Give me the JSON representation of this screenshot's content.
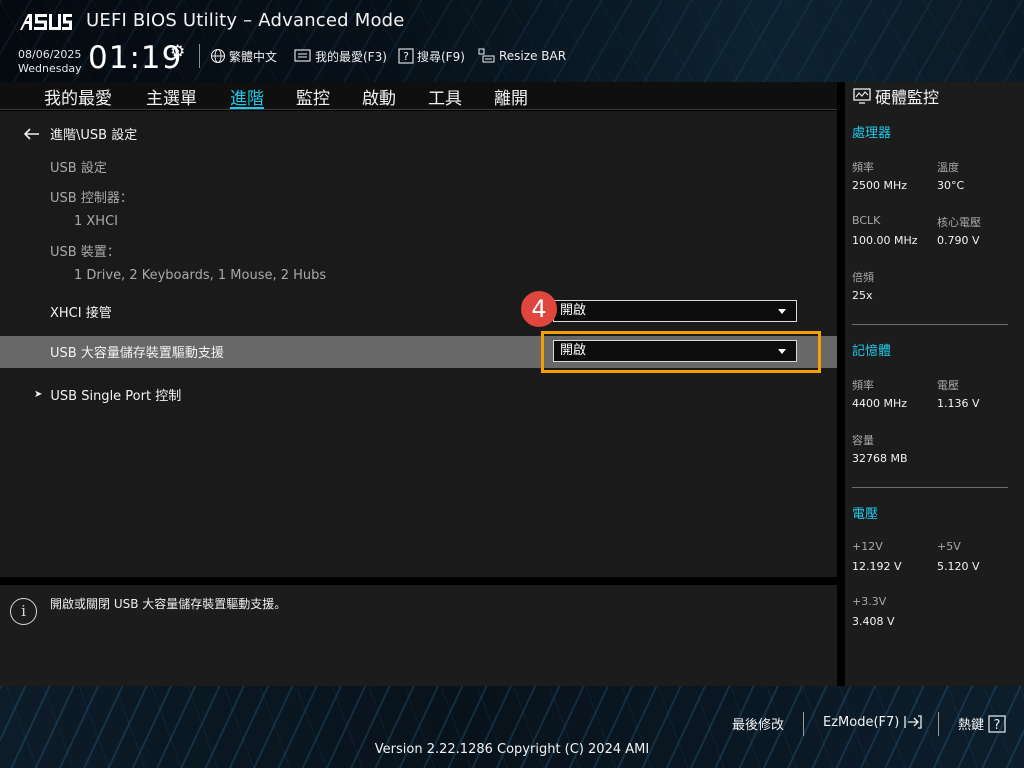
{
  "header": {
    "brand": "ASUS",
    "title": "UEFI BIOS Utility – Advanced Mode",
    "date": "08/06/2025",
    "weekday": "Wednesday",
    "time": "01:19",
    "buttons": {
      "language": "繁體中文",
      "favorites": "我的最愛(F3)",
      "search": "搜尋(F9)",
      "resize_bar": "Resize BAR"
    }
  },
  "tabs": [
    "我的最愛",
    "主選單",
    "進階",
    "監控",
    "啟動",
    "工具",
    "離開"
  ],
  "active_tab": "進階",
  "main": {
    "breadcrumb": "進階\\USB 設定",
    "info": {
      "usb_settings": "USB 設定",
      "controller_label": "USB 控制器：",
      "controller_value": "1 XHCI",
      "devices_label": "USB 裝置：",
      "devices_value": "1 Drive, 2 Keyboards, 1 Mouse, 2 Hubs"
    },
    "items": [
      {
        "label": "XHCI 接管",
        "value": "開啟"
      },
      {
        "label": "USB 大容量儲存裝置驅動支援",
        "value": "開啟"
      }
    ],
    "submenu": "USB Single Port 控制",
    "step_badge": "4"
  },
  "help": {
    "icon": "i",
    "text": "開啟或關閉 USB 大容量儲存裝置驅動支援。"
  },
  "monitor": {
    "title": "硬體監控",
    "cpu": {
      "title": "處理器",
      "freq_label": "頻率",
      "freq": "2500 MHz",
      "temp_label": "溫度",
      "temp": "30°C",
      "bclk_label": "BCLK",
      "bclk": "100.00 MHz",
      "vcore_label": "核心電壓",
      "vcore": "0.790 V",
      "ratio_label": "倍頻",
      "ratio": "25x"
    },
    "memory": {
      "title": "記憶體",
      "freq_label": "頻率",
      "freq": "4400 MHz",
      "volt_label": "電壓",
      "volt": "1.136 V",
      "cap_label": "容量",
      "cap": "32768 MB"
    },
    "voltage": {
      "title": "電壓",
      "v12_label": "+12V",
      "v12": "12.192 V",
      "v5_label": "+5V",
      "v5": "5.120 V",
      "v33_label": "+3.3V",
      "v33": "3.408 V"
    }
  },
  "footer": {
    "last_modified": "最後修改",
    "ezmode": "EzMode(F7)",
    "hotkeys": "熱鍵",
    "hotkey_glyph": "?",
    "version": "Version 2.22.1286 Copyright (C) 2024 AMI"
  },
  "colors": {
    "accent": "#1ec8e8",
    "highlight_row": "#686868",
    "focus_border": "#f5a000",
    "step_badge": "#e0463d"
  }
}
